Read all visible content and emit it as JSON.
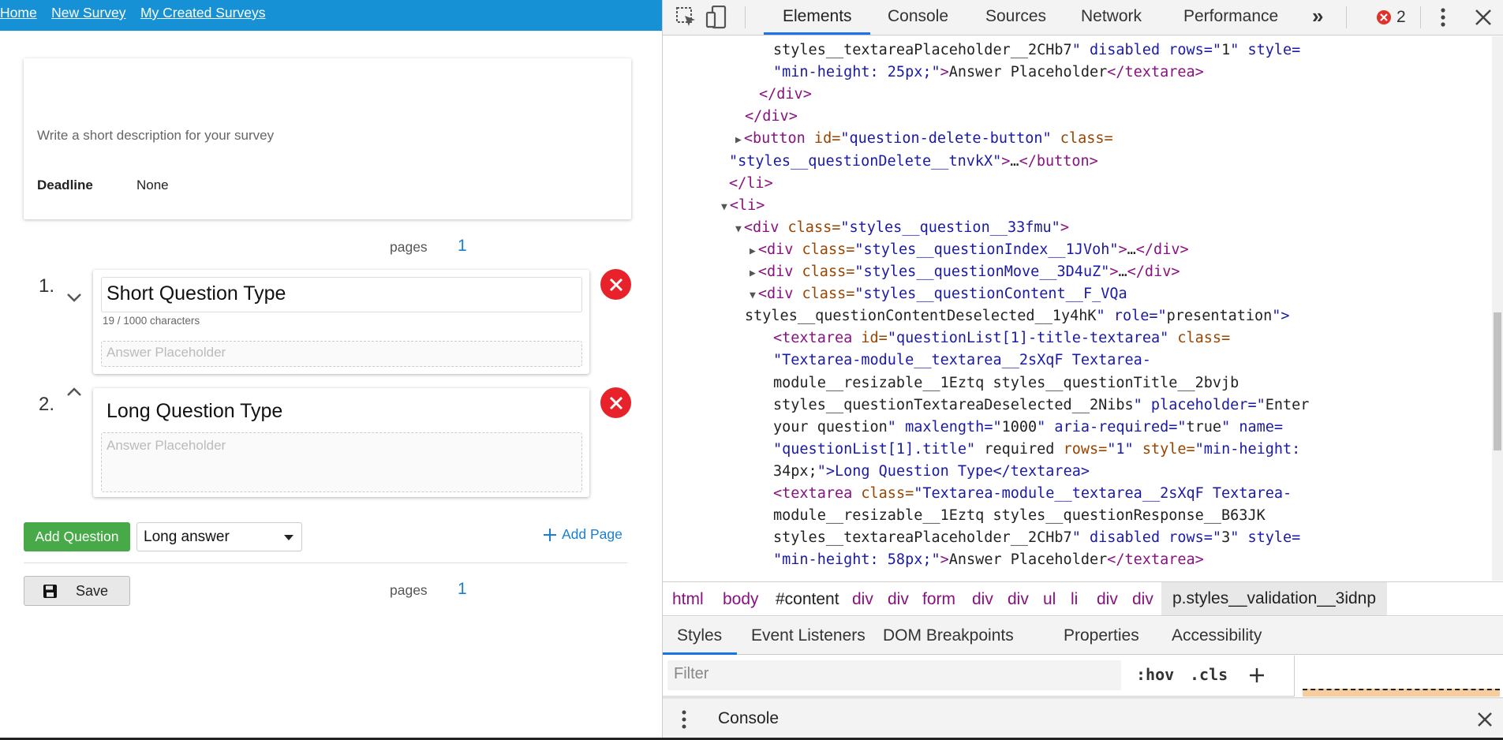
{
  "nav": {
    "links": [
      "Home",
      "New Survey",
      "My Created Surveys"
    ]
  },
  "survey": {
    "description_placeholder": "Write a short description for your survey",
    "deadline_label": "Deadline",
    "deadline_value": "None"
  },
  "pager": {
    "label": "pages",
    "page": "1"
  },
  "questions": [
    {
      "index": "1.",
      "title": "Short Question Type",
      "char_count": "19 / 1000 characters",
      "answer_placeholder": "Answer Placeholder"
    },
    {
      "index": "2.",
      "title": "Long Question Type",
      "answer_placeholder": "Answer Placeholder"
    }
  ],
  "controls": {
    "add_question": "Add Question",
    "question_type": "Long answer",
    "add_page": "Add Page",
    "save": "Save"
  },
  "colors": {
    "navbar": "#1791d6",
    "add_button": "#47a947",
    "delete_button": "#e8222a",
    "link_blue": "#1a7fd4"
  },
  "devtools": {
    "tabs": [
      "Elements",
      "Console",
      "Sources",
      "Network",
      "Performance"
    ],
    "more_tabs": "»",
    "error_count": "2",
    "breadcrumbs": [
      "html",
      "body",
      "#content",
      "div",
      "div",
      "form",
      "div",
      "div",
      "ul",
      "li",
      "div",
      "div",
      "p.styles__validation__3idnp"
    ],
    "subtabs": [
      "Styles",
      "Event Listeners",
      "DOM Breakpoints",
      "Properties",
      "Accessibility"
    ],
    "filter_placeholder": "Filter",
    "hov": ":hov",
    "cls": ".cls",
    "drawer_tab": "Console",
    "code": [
      "styles__textareaPlaceholder__2CHb7\" disabled rows=\"1\" style=",
      "\"min-height: 25px;\">Answer Placeholder</textarea>",
      "</div>",
      "</div>",
      "<button id=\"question-delete-button\" class=",
      "\"styles__questionDelete__tnvkX\">…</button>",
      "</li>",
      "<li>",
      "<div class=\"styles__question__33fmu\">",
      "<div class=\"styles__questionIndex__1JVoh\">…</div>",
      "<div class=\"styles__questionMove__3D4uZ\">…</div>",
      "<div class=\"styles__questionContent__F_VQa",
      "styles__questionContentDeselected__1y4hK\" role=\"presentation\">",
      "<textarea id=\"questionList[1]-title-textarea\" class=",
      "\"Textarea-module__textarea__2sXqF Textarea-",
      "module__resizable__1Eztq styles__questionTitle__2bvjb",
      "styles__questionTextareaDeselected__2Nibs\" placeholder=\"Enter",
      "your question\" maxlength=\"1000\" aria-required=\"true\" name=",
      "\"questionList[1].title\" required rows=\"1\" style=\"min-height:",
      "34px;\">Long Question Type</textarea>",
      "<textarea class=\"Textarea-module__textarea__2sXqF Textarea-",
      "module__resizable__1Eztq styles__questionResponse__B63JK",
      "styles__textareaPlaceholder__2CHb7\" disabled rows=\"3\" style=",
      "\"min-height: 58px;\">Answer Placeholder</textarea>"
    ]
  }
}
